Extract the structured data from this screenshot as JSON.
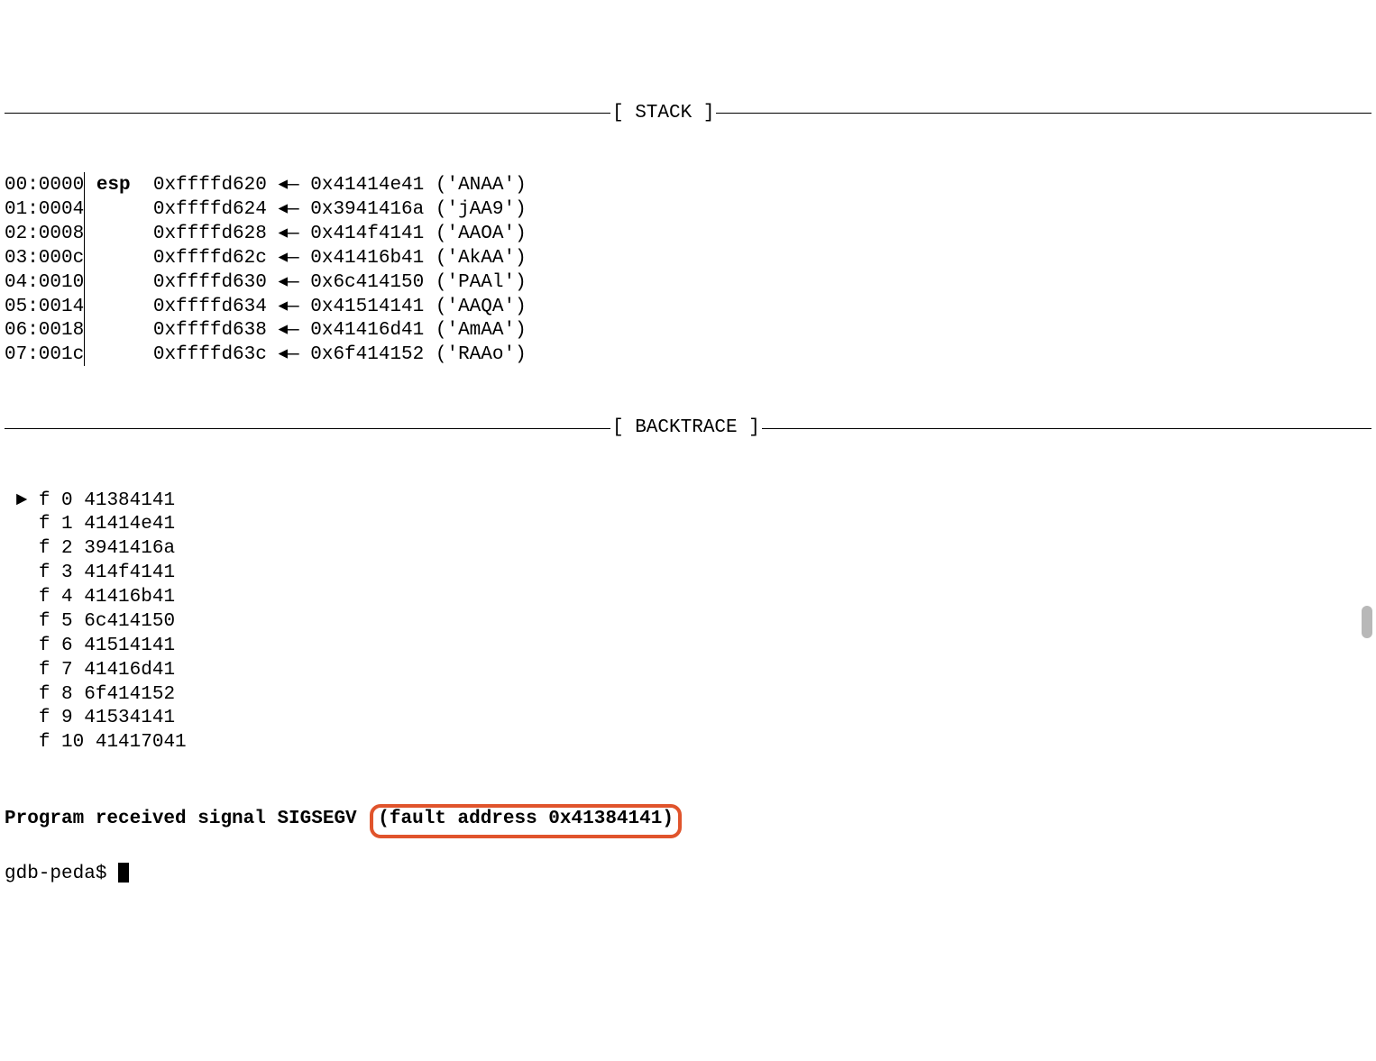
{
  "sections": {
    "stack_label": "[ STACK ]",
    "backtrace_label": "[ BACKTRACE ]"
  },
  "stack": {
    "register": "esp",
    "rows": [
      {
        "offset": "00:0000",
        "reg": "esp",
        "addr": "0xffffd620",
        "value": "0x41414e41",
        "ascii": "'ANAA'"
      },
      {
        "offset": "01:0004",
        "reg": "",
        "addr": "0xffffd624",
        "value": "0x3941416a",
        "ascii": "'jAA9'"
      },
      {
        "offset": "02:0008",
        "reg": "",
        "addr": "0xffffd628",
        "value": "0x414f4141",
        "ascii": "'AAOA'"
      },
      {
        "offset": "03:000c",
        "reg": "",
        "addr": "0xffffd62c",
        "value": "0x41416b41",
        "ascii": "'AkAA'"
      },
      {
        "offset": "04:0010",
        "reg": "",
        "addr": "0xffffd630",
        "value": "0x6c414150",
        "ascii": "'PAAl'"
      },
      {
        "offset": "05:0014",
        "reg": "",
        "addr": "0xffffd634",
        "value": "0x41514141",
        "ascii": "'AAQA'"
      },
      {
        "offset": "06:0018",
        "reg": "",
        "addr": "0xffffd638",
        "value": "0x41416d41",
        "ascii": "'AmAA'"
      },
      {
        "offset": "07:001c",
        "reg": "",
        "addr": "0xffffd63c",
        "value": "0x6f414152",
        "ascii": "'RAAo'"
      }
    ]
  },
  "backtrace": [
    {
      "marker": "►",
      "label": "f 0",
      "addr": "41384141"
    },
    {
      "marker": " ",
      "label": "f 1",
      "addr": "41414e41"
    },
    {
      "marker": " ",
      "label": "f 2",
      "addr": "3941416a"
    },
    {
      "marker": " ",
      "label": "f 3",
      "addr": "414f4141"
    },
    {
      "marker": " ",
      "label": "f 4",
      "addr": "41416b41"
    },
    {
      "marker": " ",
      "label": "f 5",
      "addr": "6c414150"
    },
    {
      "marker": " ",
      "label": "f 6",
      "addr": "41514141"
    },
    {
      "marker": " ",
      "label": "f 7",
      "addr": "41416d41"
    },
    {
      "marker": " ",
      "label": "f 8",
      "addr": "6f414152"
    },
    {
      "marker": " ",
      "label": "f 9",
      "addr": "41534141"
    },
    {
      "marker": " ",
      "label": "f 10",
      "addr": "41417041"
    }
  ],
  "signal": {
    "prefix": "Program received signal SIGSEGV",
    "fault": "(fault address 0x41384141)"
  },
  "prompt": "gdb-peda$ "
}
